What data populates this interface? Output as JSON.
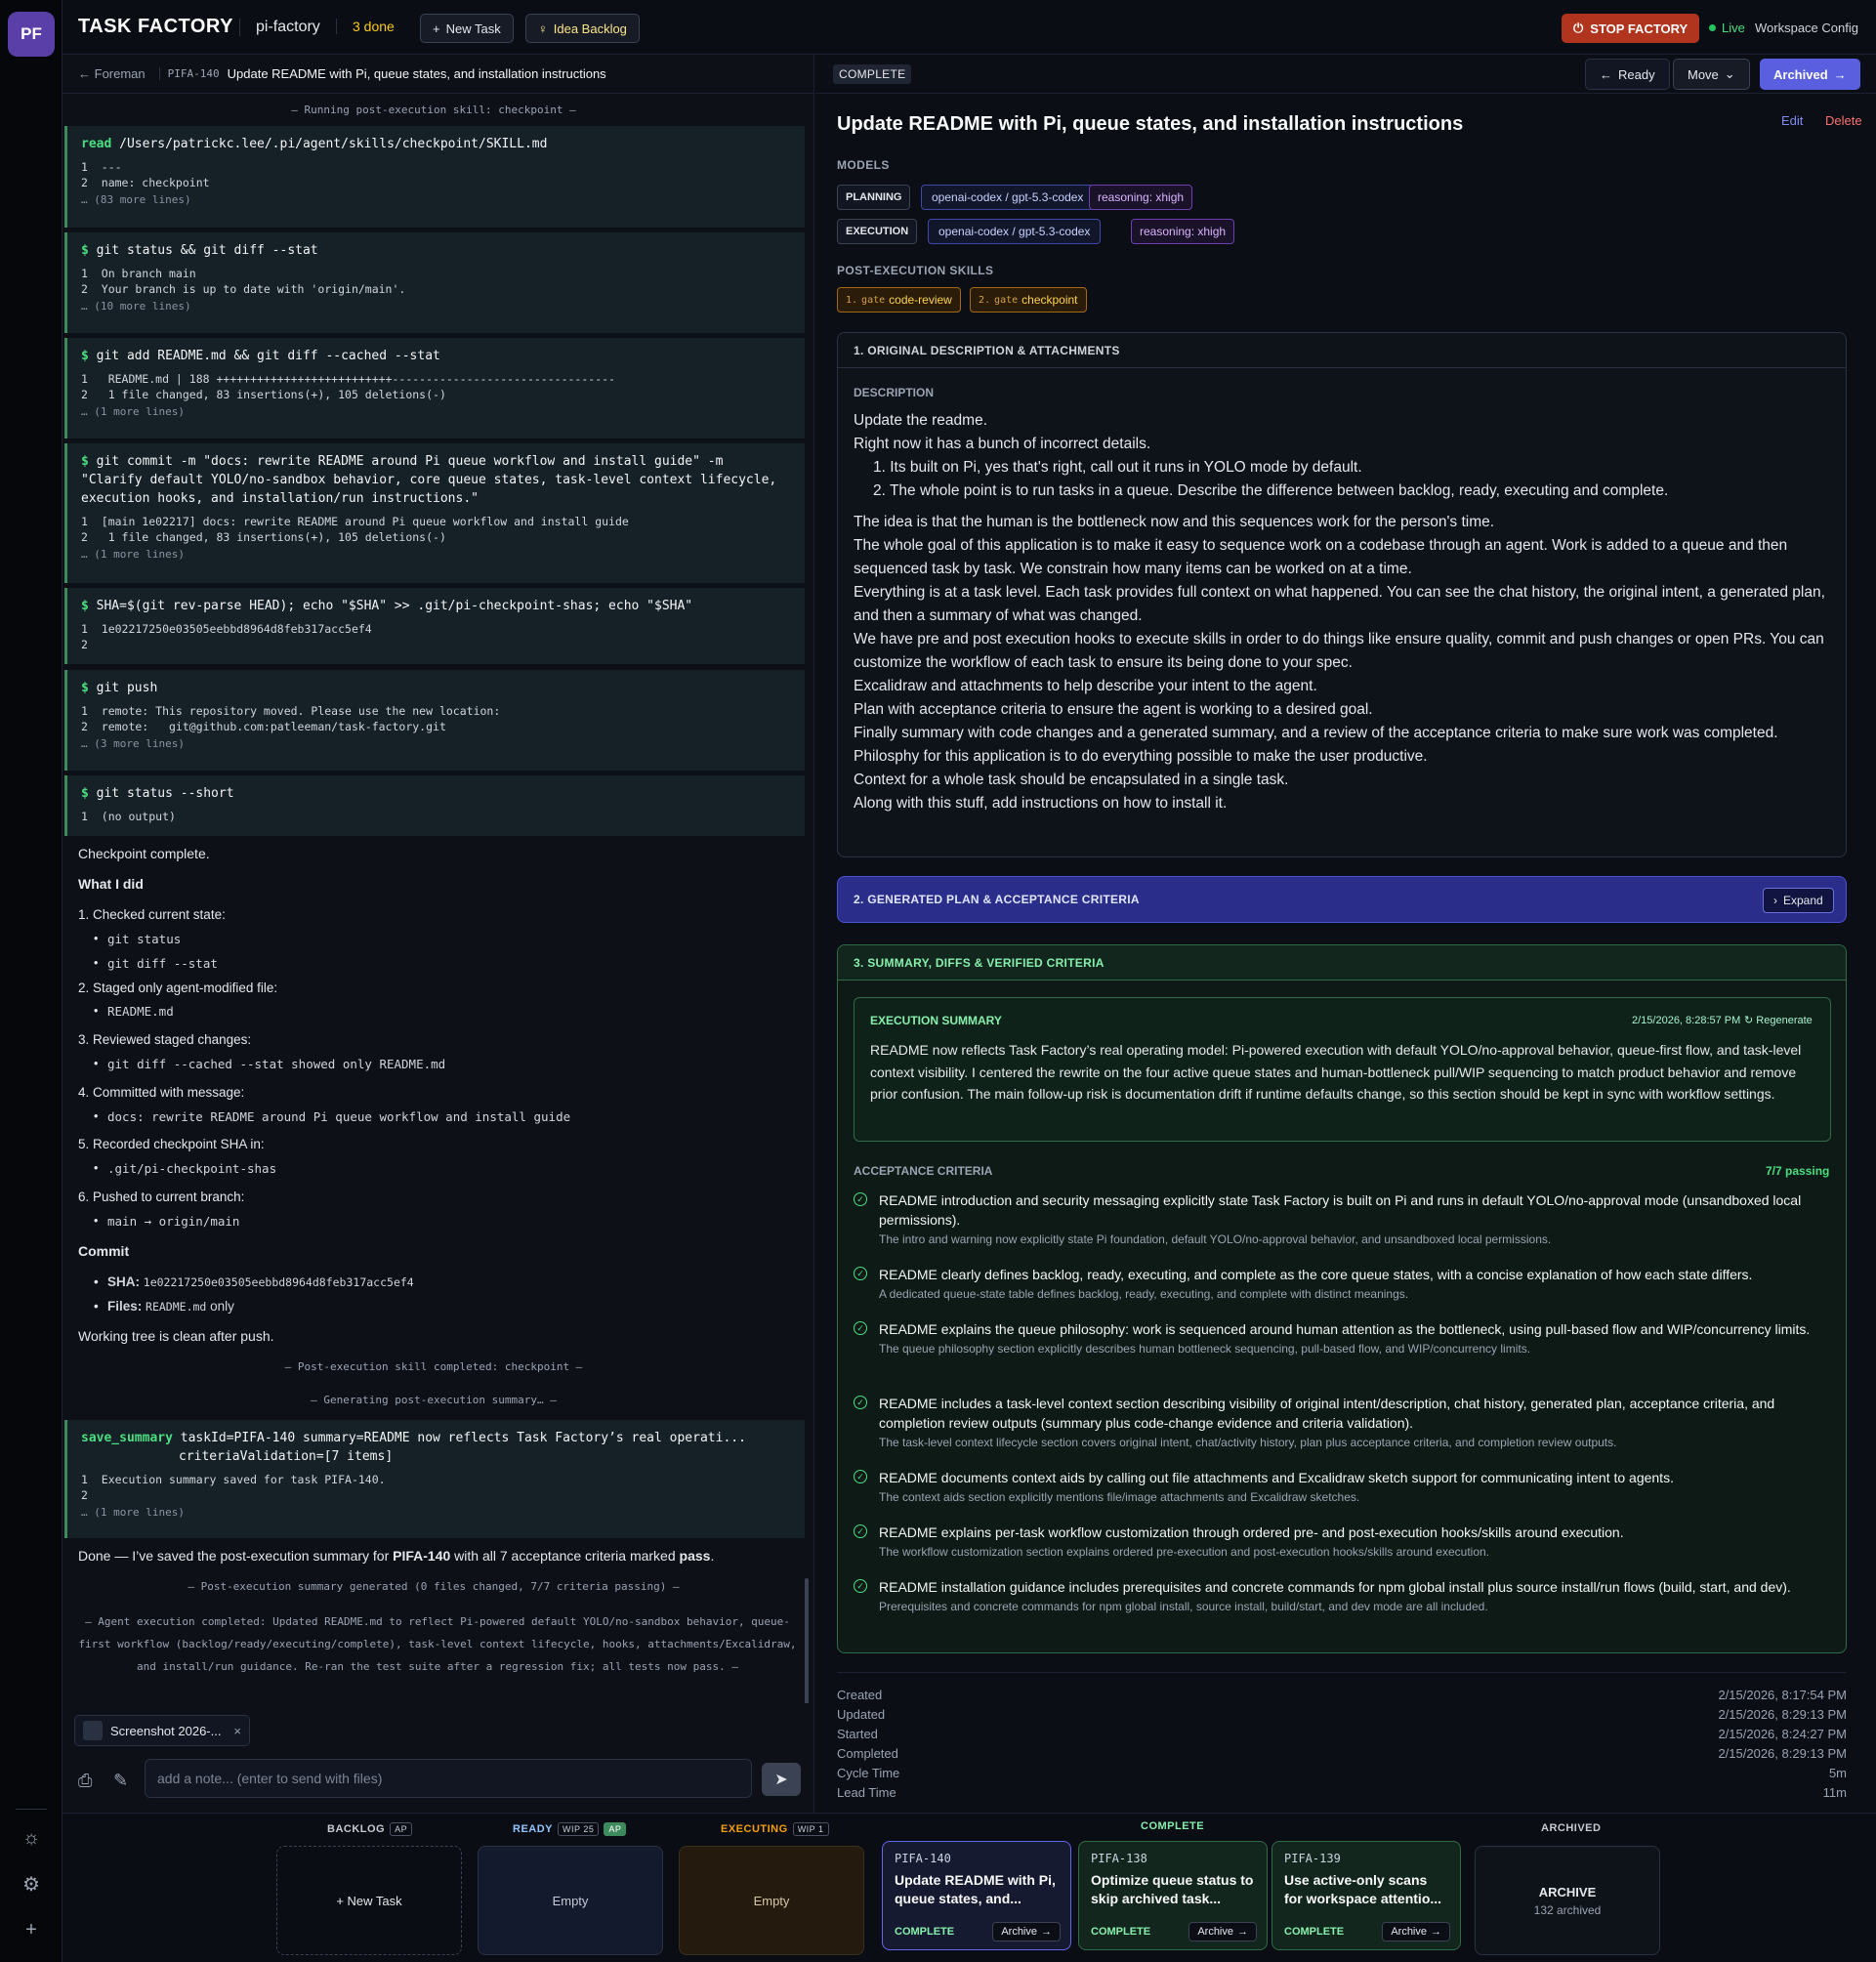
{
  "app": {
    "avatar": "PF",
    "title": "TASK FACTORY",
    "project": "pi-factory",
    "done_count": "3 done",
    "new_task": "New Task",
    "idea_backlog": "Idea Backlog",
    "stop": "STOP FACTORY",
    "live": "Live",
    "workspace_config": "Workspace Config"
  },
  "left": {
    "back": "Foreman",
    "task_id": "PIFA-140",
    "task_title": "Update README with Pi, queue states, and installation instructions",
    "sep1": "— Running post-execution skill: checkpoint —",
    "tools": [
      {
        "prefix": "read",
        "cmd": "/Users/patrickc.lee/.pi/agent/skills/checkpoint/SKILL.md",
        "out": "1  ---\n2  name: checkpoint",
        "more": "… (83 more lines)"
      },
      {
        "prefix": "$",
        "cmd": "git status && git diff --stat",
        "out": "1  On branch main\n2  Your branch is up to date with 'origin/main'.",
        "more": "… (10 more lines)"
      },
      {
        "prefix": "$",
        "cmd": "git add README.md && git diff --cached --stat",
        "out": "1   README.md | 188 ++++++++++++++++++++++++++---------------------------------\n2   1 file changed, 83 insertions(+), 105 deletions(-)",
        "more": "… (1 more lines)"
      },
      {
        "prefix": "$",
        "cmd": "git commit -m \"docs: rewrite README around Pi queue workflow and install guide\" -m \"Clarify default YOLO/no-sandbox behavior, core queue states, task-level context lifecycle, execution hooks, and installation/run instructions.\"",
        "out": "1  [main 1e02217] docs: rewrite README around Pi queue workflow and install guide\n2   1 file changed, 83 insertions(+), 105 deletions(-)",
        "more": "… (1 more lines)"
      },
      {
        "prefix": "$",
        "cmd": "SHA=$(git rev-parse HEAD); echo \"$SHA\" >> .git/pi-checkpoint-shas; echo \"$SHA\"",
        "out": "1  1e02217250e03505eebbd8964d8feb317acc5ef4\n2",
        "more": ""
      },
      {
        "prefix": "$",
        "cmd": "git push",
        "out": "1  remote: This repository moved. Please use the new location:\n2  remote:   git@github.com:patleeman/task-factory.git",
        "more": "… (3 more lines)"
      },
      {
        "prefix": "$",
        "cmd": "git status --short",
        "out": "1  (no output)",
        "more": ""
      }
    ],
    "checkpoint_complete": "Checkpoint complete.",
    "what_i_did": "What I did",
    "steps": [
      {
        "label": "1. Checked current state:",
        "bullets": [
          "git status",
          "git diff --stat"
        ]
      },
      {
        "label": "2. Staged only agent-modified file:",
        "bullets": [
          "README.md"
        ]
      },
      {
        "label": "3. Reviewed staged changes:",
        "bullets": [
          "git diff --cached --stat showed only README.md"
        ]
      },
      {
        "label": "4. Committed with message:",
        "bullets": [
          "docs: rewrite README around Pi queue workflow and install guide"
        ]
      },
      {
        "label": "5. Recorded checkpoint SHA in:",
        "bullets": [
          ".git/pi-checkpoint-shas"
        ]
      },
      {
        "label": "6. Pushed to current branch:",
        "bullets": [
          "main → origin/main"
        ]
      }
    ],
    "commit_heading": "Commit",
    "commit_sha_label": "SHA:",
    "commit_sha": "1e02217250e03505eebbd8964d8feb317acc5ef4",
    "commit_files_label": "Files:",
    "commit_files": "README.md",
    "commit_files_suffix": "only",
    "working_tree": "Working tree is clean after push.",
    "sep2": "— Post-execution skill completed: checkpoint —",
    "sep3": "— Generating post-execution summary… —",
    "save_tool": {
      "prefix": "save_summary",
      "cmd": "taskId=PIFA-140 summary=README now reflects Task Factory’s real operati... criteriaValidation=[7 items]",
      "out": "1  Execution summary saved for task PIFA-140.\n2",
      "more": "… (1 more lines)"
    },
    "done_msg_a": "Done — I’ve saved the post-execution summary for ",
    "done_msg_task": "PIFA-140",
    "done_msg_b": " with all 7 acceptance criteria marked ",
    "done_msg_pass": "pass",
    "done_msg_c": ".",
    "sep4": "— Post-execution summary generated (0 files changed, 7/7 criteria passing) —",
    "sep5": "— Agent execution completed: Updated README.md to reflect Pi-powered default YOLO/no-sandbox behavior, queue-first workflow (backlog/ready/executing/complete), task-level context lifecycle, hooks, attachments/Excalidraw, and install/run guidance. Re-ran the test suite after a regression fix; all tests now pass. —",
    "attachment": "Screenshot 2026-...",
    "note_placeholder": "add a note... (enter to send with files)"
  },
  "right": {
    "status": "COMPLETE",
    "ready": "Ready",
    "move": "Move",
    "archived": "Archived",
    "title": "Update README with Pi, queue states, and installation instructions",
    "edit": "Edit",
    "delete": "Delete",
    "models_label": "MODELS",
    "planning": {
      "tag": "PLANNING",
      "model": "openai-codex  /  gpt-5.3-codex",
      "reasoning": "reasoning: xhigh"
    },
    "execution": {
      "tag": "EXECUTION",
      "model": "openai-codex  /  gpt-5.3-codex",
      "reasoning": "reasoning: xhigh"
    },
    "skills_label": "POST-EXECUTION SKILLS",
    "skills": [
      {
        "num": "1.",
        "kind": "gate",
        "name": "code-review"
      },
      {
        "num": "2.",
        "kind": "gate",
        "name": "checkpoint"
      }
    ],
    "sec1_title": "1. ORIGINAL DESCRIPTION & ATTACHMENTS",
    "desc_label": "DESCRIPTION",
    "desc_lines": [
      "Update the readme.",
      "Right now it has a bunch of incorrect details.",
      "1. Its built on Pi, yes that's right, call out it runs in YOLO mode by default.",
      "2. The whole point is to run tasks in a queue. Describe the difference between backlog, ready, executing and complete.",
      "The idea is that the human is the bottleneck now and this sequences work for the person's time.",
      "The whole goal of this application is to make it easy to sequence work on a codebase through an agent. Work is added to a queue and then sequenced task by task. We constrain how many items can be worked on at a time.",
      "Everything is at a task level. Each task provides full context on what happened. You can see the chat history, the original intent, a generated plan, and then a summary of what was changed.",
      "We have pre and post execution hooks to execute skills in order to do things like ensure quality, commit and push changes or open PRs. You can customize the workflow of each task to ensure its being done to your spec.",
      "Excalidraw and attachments to help describe your intent to the agent.",
      "Plan with acceptance criteria to ensure the agent is working to a desired goal.",
      "Finally summary with code changes and a generated summary, and a review of the acceptance criteria to make sure work was completed.",
      "Philosphy for this application is to do everything possible to make the user productive.",
      "Context for a whole task should be encapsulated in a single task.",
      "Along with this stuff, add instructions on how to install it."
    ],
    "sec2_title": "2. GENERATED PLAN & ACCEPTANCE CRITERIA",
    "expand": "Expand",
    "sec3_title": "3. SUMMARY, DIFFS & VERIFIED CRITERIA",
    "exec_label": "EXECUTION SUMMARY",
    "exec_time": "2/15/2026, 8:28:57 PM",
    "regenerate": "Regenerate",
    "exec_text": "README now reflects Task Factory’s real operating model: Pi-powered execution with default YOLO/no-approval behavior, queue-first flow, and task-level context visibility. I centered the rewrite on the four active queue states and human-bottleneck pull/WIP sequencing to match product behavior and remove prior confusion. The main follow-up risk is documentation drift if runtime defaults change, so this section should be kept in sync with workflow settings.",
    "ac_label": "ACCEPTANCE CRITERIA",
    "ac_pass": "7/7 passing",
    "criteria": [
      {
        "title": "README introduction and security messaging explicitly state Task Factory is built on Pi and runs in default YOLO/no-approval mode (unsandboxed local permissions).",
        "sub": "The intro and warning now explicitly state Pi foundation, default YOLO/no-approval behavior, and unsandboxed local permissions."
      },
      {
        "title": "README clearly defines backlog, ready, executing, and complete as the core queue states, with a concise explanation of how each state differs.",
        "sub": "A dedicated queue-state table defines backlog, ready, executing, and complete with distinct meanings."
      },
      {
        "title": "README explains the queue philosophy: work is sequenced around human attention as the bottleneck, using pull-based flow and WIP/concurrency limits.",
        "sub": "The queue philosophy section explicitly describes human bottleneck sequencing, pull-based flow, and WIP/concurrency limits."
      },
      {
        "title": "README includes a task-level context section describing visibility of original intent/description, chat history, generated plan, acceptance criteria, and completion review outputs (summary plus code-change evidence and criteria validation).",
        "sub": "The task-level context lifecycle section covers original intent, chat/activity history, plan plus acceptance criteria, and completion review outputs."
      },
      {
        "title": "README documents context aids by calling out file attachments and Excalidraw sketch support for communicating intent to agents.",
        "sub": "The context aids section explicitly mentions file/image attachments and Excalidraw sketches."
      },
      {
        "title": "README explains per-task workflow customization through ordered pre- and post-execution hooks/skills around execution.",
        "sub": "The workflow customization section explains ordered pre-execution and post-execution hooks/skills around execution."
      },
      {
        "title": "README installation guidance includes prerequisites and concrete commands for npm global install plus source install/run flows (build, start, and dev).",
        "sub": "Prerequisites and concrete commands for npm global install, source install, build/start, and dev mode are all included."
      }
    ],
    "meta": [
      {
        "k": "Created",
        "v": "2/15/2026, 8:17:54 PM"
      },
      {
        "k": "Updated",
        "v": "2/15/2026, 8:29:13 PM"
      },
      {
        "k": "Started",
        "v": "2/15/2026, 8:24:27 PM"
      },
      {
        "k": "Completed",
        "v": "2/15/2026, 8:29:13 PM"
      },
      {
        "k": "Cycle Time",
        "v": "5m"
      },
      {
        "k": "Lead Time",
        "v": "11m"
      }
    ]
  },
  "board": {
    "backlog": {
      "label": "BACKLOG",
      "badge": "AP",
      "card": "+ New Task"
    },
    "ready": {
      "label": "READY",
      "badge": "WIP 25",
      "badge2": "AP",
      "card": "Empty"
    },
    "executing": {
      "label": "EXECUTING",
      "badge": "WIP 1",
      "card": "Empty"
    },
    "complete": {
      "label": "COMPLETE"
    },
    "archived": {
      "label": "ARCHIVED",
      "title": "ARCHIVE",
      "count": "132 archived"
    },
    "tasks": [
      {
        "id": "PIFA-140",
        "title": "Update README with Pi, queue states, and...",
        "status": "COMPLETE",
        "action": "Archive"
      },
      {
        "id": "PIFA-138",
        "title": "Optimize queue status to skip archived task...",
        "status": "COMPLETE",
        "action": "Archive"
      },
      {
        "id": "PIFA-139",
        "title": "Use active-only scans for workspace attentio...",
        "status": "COMPLETE",
        "action": "Archive"
      }
    ]
  },
  "colors": {
    "accent": "#5a5fe0",
    "stop": "#b0341e",
    "success": "#4ade80",
    "plan": "#2a2d8a"
  },
  "icons": [
    "sun-icon",
    "gear-icon",
    "plus-icon",
    "paperclip-icon",
    "pen-icon",
    "send-icon",
    "check-circle-icon",
    "refresh-icon",
    "lightbulb-icon",
    "power-icon"
  ]
}
